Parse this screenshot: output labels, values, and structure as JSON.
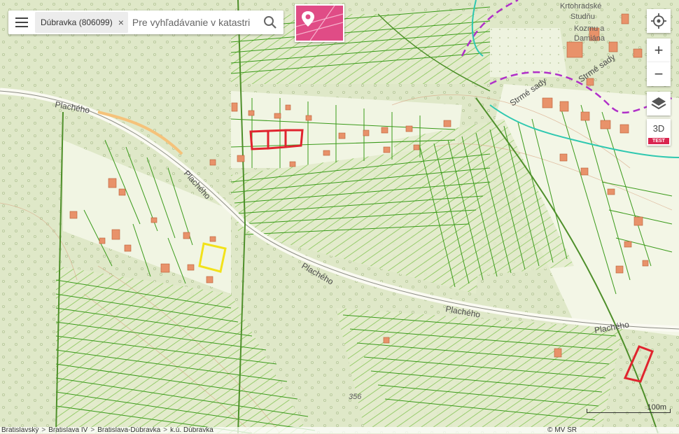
{
  "search": {
    "chip_label": "Dúbravka (806099)",
    "chip_close": "×",
    "placeholder": "Pre vyhľadávanie v katastri"
  },
  "map": {
    "street_labels": [
      "Plachého",
      "Plachého",
      "Plachého",
      "Plachého",
      "Plachého",
      "Strmé sady",
      "Strmé sady",
      "Krtohradské",
      "Studňu",
      "Kozmu a",
      "Damiána"
    ],
    "elevation_label": "356"
  },
  "controls": {
    "zoom_in": "+",
    "zoom_out": "−",
    "mode_3d": "3D",
    "test_badge": "TEST"
  },
  "scale": {
    "label": "100m"
  },
  "breadcrumb": [
    "Bratislavský",
    "Bratislava IV",
    "Bratislava-Dúbravka",
    "k.ú. Dúbravka"
  ],
  "breadcrumb_separator": ">",
  "copyright": "© MV SR",
  "colors": {
    "parcel_line": "#3a9a1a",
    "forest_fill": "#dde7c6",
    "building": "#e8926a",
    "highlight_red": "#e0242e",
    "highlight_yellow": "#f2e21a",
    "district_magenta": "#b030c8",
    "district_teal": "#2fc8b0",
    "poi_pink": "#e04c86"
  }
}
